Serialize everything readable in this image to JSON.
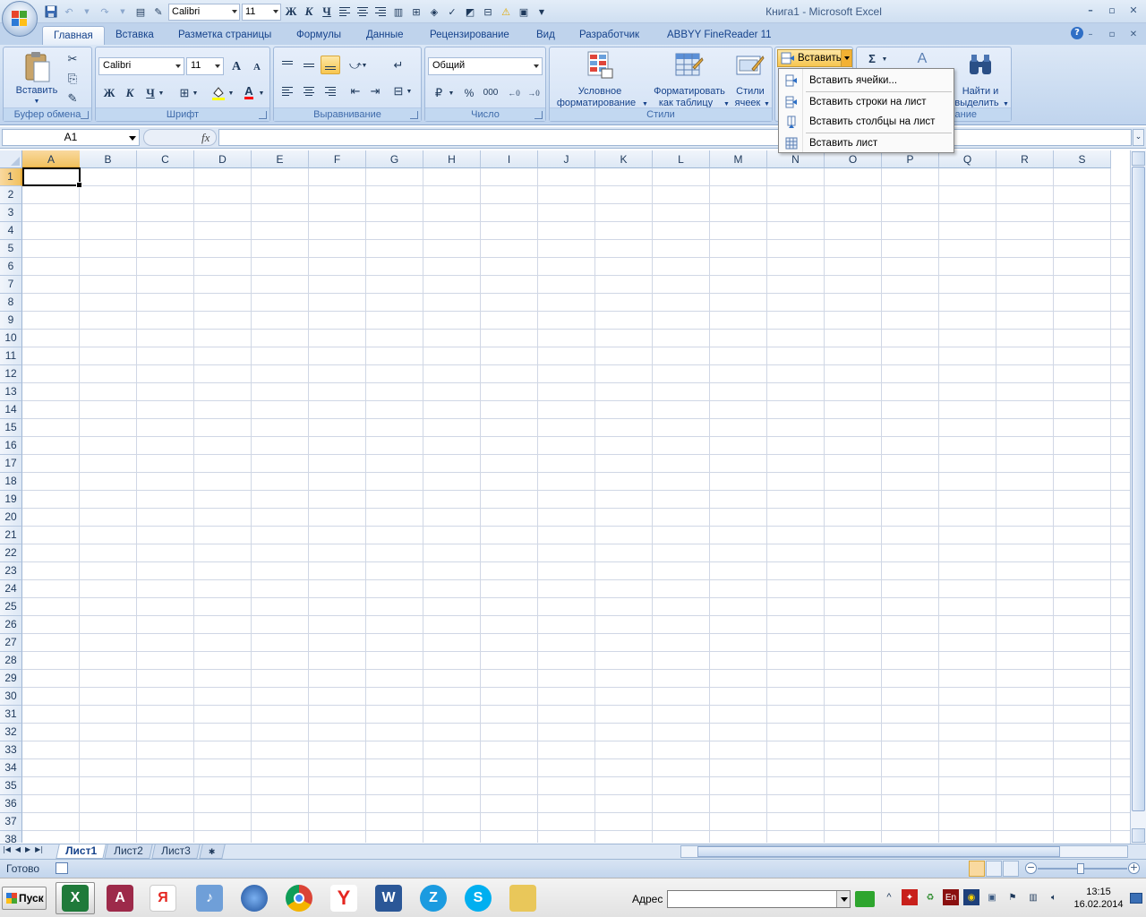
{
  "window": {
    "title": "Книга1 - Microsoft Excel"
  },
  "qat": {
    "font": "Calibri",
    "size": "11",
    "bold": "Ж",
    "italic": "К",
    "underline": "Ч"
  },
  "tabs": [
    {
      "label": "Главная"
    },
    {
      "label": "Вставка"
    },
    {
      "label": "Разметка страницы"
    },
    {
      "label": "Формулы"
    },
    {
      "label": "Данные"
    },
    {
      "label": "Рецензирование"
    },
    {
      "label": "Вид"
    },
    {
      "label": "Разработчик"
    },
    {
      "label": "ABBYY FineReader 11"
    }
  ],
  "ribbon": {
    "clipboard": {
      "paste_label": "Вставить",
      "group_label": "Буфер обмена"
    },
    "font": {
      "name": "Calibri",
      "size": "11",
      "bold": "Ж",
      "italic": "К",
      "underline": "Ч",
      "group_label": "Шрифт",
      "grow": "A",
      "shrink": "A",
      "color_letter": "A"
    },
    "alignment": {
      "group_label": "Выравнивание"
    },
    "number": {
      "format": "Общий",
      "group_label": "Число",
      "percent": "%",
      "thousands": "000"
    },
    "styles": {
      "conditional_label_1": "Условное",
      "conditional_label_2": "форматирование",
      "table_label_1": "Форматировать",
      "table_label_2": "как таблицу",
      "cell_styles_1": "Стили",
      "cell_styles_2": "ячеек",
      "group_label": "Стили"
    },
    "cells": {
      "insert_label": "Вставить"
    },
    "editing": {
      "sigma": "Σ",
      "find_1": "Найти и",
      "find_2": "выделить",
      "group_label_fragment": "ание"
    }
  },
  "insert_menu": {
    "items": [
      {
        "label": "Вставить ячейки..."
      },
      {
        "label": "Вставить строки на лист"
      },
      {
        "label": "Вставить столбцы на лист"
      },
      {
        "label": "Вставить лист"
      }
    ]
  },
  "formula_bar": {
    "name_box": "A1",
    "fx": "fx",
    "formula": ""
  },
  "grid": {
    "columns": [
      "A",
      "B",
      "C",
      "D",
      "E",
      "F",
      "G",
      "H",
      "I",
      "J",
      "K",
      "L",
      "M",
      "N",
      "O",
      "P",
      "Q",
      "R",
      "S"
    ],
    "rows": [
      "1",
      "2",
      "3",
      "4",
      "5",
      "6",
      "7",
      "8",
      "9",
      "10",
      "11",
      "12",
      "13",
      "14",
      "15",
      "16",
      "17",
      "18",
      "19",
      "20",
      "21",
      "22",
      "23",
      "24",
      "25",
      "26",
      "27",
      "28",
      "29",
      "30",
      "31",
      "32",
      "33",
      "34",
      "35",
      "36",
      "37",
      "38"
    ],
    "selected_column": "A",
    "selected_row": "1"
  },
  "sheets": [
    {
      "label": "Лист1"
    },
    {
      "label": "Лист2"
    },
    {
      "label": "Лист3"
    }
  ],
  "status": {
    "text": "Готово"
  },
  "taskbar": {
    "start": "Пуск",
    "address_label": "Адрес",
    "address_value": "",
    "clock_time": "13:15",
    "clock_date": "16.02.2014",
    "lang": "En"
  }
}
